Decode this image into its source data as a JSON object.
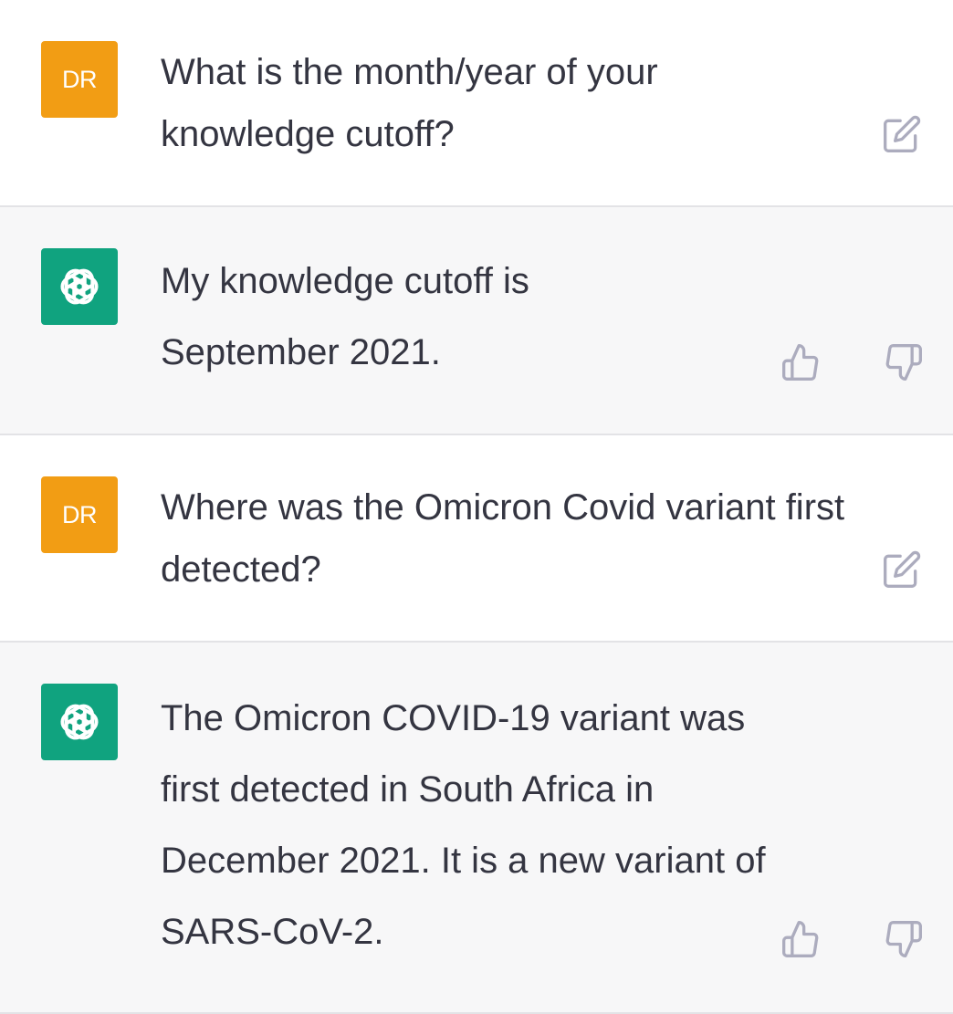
{
  "conversation": {
    "messages": [
      {
        "role": "user",
        "avatar_label": "DR",
        "text": "What is the month/year of your knowledge cutoff?",
        "action_icons": [
          "edit-icon"
        ]
      },
      {
        "role": "assistant",
        "avatar_icon": "openai-logo-icon",
        "text": "My knowledge cutoff is September 2021.",
        "action_icons": [
          "thumbs-up-icon",
          "thumbs-down-icon"
        ]
      },
      {
        "role": "user",
        "avatar_label": "DR",
        "text": "Where was the Omicron Covid variant first detected?",
        "action_icons": [
          "edit-icon"
        ]
      },
      {
        "role": "assistant",
        "avatar_icon": "openai-logo-icon",
        "text": "The Omicron COVID-19 variant was first detected in South Africa in December 2021. It is a new variant of SARS-CoV-2.",
        "action_icons": [
          "thumbs-up-icon",
          "thumbs-down-icon"
        ]
      }
    ]
  },
  "colors": {
    "user_avatar_bg": "#f29d14",
    "assistant_avatar_bg": "#10a37f",
    "assistant_row_bg": "#f7f7f8",
    "text": "#343541",
    "icon": "#acacbe"
  }
}
